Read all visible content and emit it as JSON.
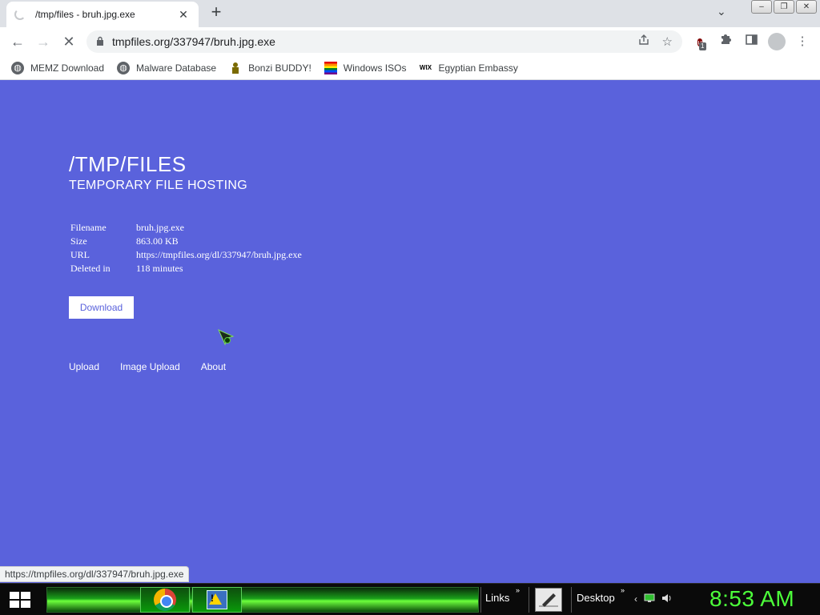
{
  "browser": {
    "tab_title": "/tmp/files - bruh.jpg.exe",
    "tab_close": "✕",
    "new_tab": "+",
    "tab_search": "⌄",
    "window_buttons": [
      "–",
      "❐",
      "✕"
    ],
    "nav": {
      "back": "←",
      "forward": "→",
      "reload": "✕"
    },
    "url": "tmpfiles.org/337947/bruh.jpg.exe",
    "lock": "🔒",
    "ublock_count": "1",
    "bookmarks": [
      {
        "label": "MEMZ Download",
        "icon": "globe-icon"
      },
      {
        "label": "Malware Database",
        "icon": "globe-icon"
      },
      {
        "label": "Bonzi BUDDY!",
        "icon": "bonzi-icon"
      },
      {
        "label": "Windows ISOs",
        "icon": "rainbow-flag-icon"
      },
      {
        "label": "Egyptian Embassy",
        "icon": "wix-icon"
      }
    ],
    "status_url": "https://tmpfiles.org/dl/337947/bruh.jpg.exe"
  },
  "page": {
    "logo": "/TMP/FILES",
    "tagline": "TEMPORARY FILE HOSTING",
    "info": [
      {
        "key": "Filename",
        "value": "bruh.jpg.exe"
      },
      {
        "key": "Size",
        "value": "863.00 KB"
      },
      {
        "key": "URL",
        "value": "https://tmpfiles.org/dl/337947/bruh.jpg.exe"
      },
      {
        "key": "Deleted in",
        "value": "118 minutes"
      }
    ],
    "download_label": "Download",
    "footer_links": [
      "Upload",
      "Image Upload",
      "About"
    ],
    "background_color": "#5a62dc"
  },
  "taskbar": {
    "links_label": "Links",
    "desktop_label": "Desktop",
    "chevron": "»",
    "clock": "8:53 AM"
  }
}
